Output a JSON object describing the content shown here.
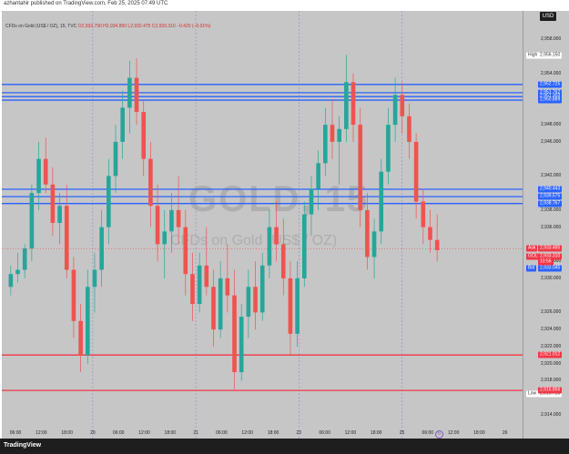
{
  "header": {
    "publisher": "azhantahir published on TradingView.com, Feb 25, 2025 07:49 UTC"
  },
  "legend": {
    "symbol": "CFDs on Gold (US$ / OZ), 15, TVC",
    "ohlc": "O2,933.790 H2,934.800 L2,932.475 C2,933.310 −0.420 (−0.01%)"
  },
  "watermark": {
    "ticker": "GOLD, 15",
    "description": "CFDs on Gold (US$ / OZ)"
  },
  "currency_button": "USD",
  "footer": {
    "logo_text": "TradingView"
  },
  "reset_icon": "reset-chart-icon",
  "colors": {
    "background": "#c6c6c6",
    "up": "#26a69a",
    "down": "#ef5350",
    "blue_level": "#2962ff",
    "red_level": "#f23645"
  },
  "chart_data": {
    "type": "candlestick",
    "symbol": "GOLD",
    "interval": "15",
    "ylim": [
      2912.5,
      2959
    ],
    "y_ticks": [
      "2,958.000",
      "2,954.000",
      "2,948.000",
      "2,946.000",
      "2,942.000",
      "2,938.000",
      "2,936.000",
      "2,932.000",
      "2,930.000",
      "2,926.000",
      "2,924.000",
      "2,922.000",
      "2,920.000",
      "2,918.000",
      "2,914.000"
    ],
    "y_tick_values": [
      2958,
      2954,
      2948,
      2946,
      2942,
      2938,
      2936,
      2932,
      2930,
      2926,
      2924,
      2922,
      2920,
      2918,
      2914
    ],
    "x_ticks": [
      "06:00",
      "12:00",
      "18:00",
      "20",
      "06:00",
      "12:00",
      "18:00",
      "21",
      "06:00",
      "12:00",
      "18:00",
      "23",
      "06:00",
      "12:00",
      "18:00",
      "25",
      "06:00",
      "12:00",
      "18:00",
      "26"
    ],
    "x_tick_positions": [
      0,
      1,
      2,
      3,
      4,
      5,
      6,
      7,
      8,
      9,
      10,
      11,
      12,
      13,
      14,
      15,
      16,
      17,
      18,
      19
    ],
    "day_separators": [
      3,
      7,
      11,
      15
    ],
    "high": {
      "label": "High",
      "value": "2,956.150",
      "y": 2956.15
    },
    "low": {
      "label": "Low",
      "value": "2,916.415",
      "y": 2916.415
    },
    "levels": [
      {
        "value": "2,952.725",
        "y": 2952.725,
        "color": "blue",
        "tag": ""
      },
      {
        "value": "2,951.762",
        "y": 2951.762,
        "color": "blue",
        "tag": ""
      },
      {
        "value": "2,951.303",
        "y": 2951.303,
        "color": "blue",
        "tag": ""
      },
      {
        "value": "2,950.889",
        "y": 2950.889,
        "color": "blue",
        "tag": ""
      },
      {
        "value": "2,940.443",
        "y": 2940.443,
        "color": "blue",
        "tag": ""
      },
      {
        "value": "2,939.575",
        "y": 2939.575,
        "color": "blue",
        "tag": ""
      },
      {
        "value": "2,938.767",
        "y": 2938.767,
        "color": "blue",
        "tag": ""
      },
      {
        "value": "2,921.012",
        "y": 2921.012,
        "color": "red",
        "tag": ""
      },
      {
        "value": "2,916.856",
        "y": 2916.856,
        "color": "red",
        "tag": ""
      }
    ],
    "price_tags": [
      {
        "label": "Ask",
        "value": "2,933.485",
        "y": 2933.485
      },
      {
        "label": "GOLD",
        "value": "2,933.310",
        "sub": "10:56",
        "y": 2932.6
      },
      {
        "label": "Bid",
        "value": "2,933.045",
        "y": 2931.2
      }
    ],
    "candles": [
      [
        2929,
        2931.5,
        2928,
        2930.5
      ],
      [
        2930.5,
        2933,
        2929.5,
        2931
      ],
      [
        2931,
        2934,
        2930,
        2933.5
      ],
      [
        2933.5,
        2941,
        2932,
        2940
      ],
      [
        2940,
        2946,
        2938,
        2944
      ],
      [
        2944,
        2946.5,
        2940,
        2941
      ],
      [
        2941,
        2943,
        2935,
        2936.5
      ],
      [
        2936.5,
        2940,
        2934,
        2938.5
      ],
      [
        2938.5,
        2941,
        2930,
        2931
      ],
      [
        2931,
        2932.5,
        2923,
        2925
      ],
      [
        2925,
        2927,
        2919,
        2921
      ],
      [
        2921,
        2931,
        2920,
        2929
      ],
      [
        2929,
        2933,
        2926,
        2931
      ],
      [
        2931,
        2938,
        2929,
        2936
      ],
      [
        2936,
        2944,
        2934,
        2942
      ],
      [
        2942,
        2948,
        2940,
        2946
      ],
      [
        2946,
        2952,
        2944,
        2950
      ],
      [
        2950,
        2955.5,
        2947,
        2953.5
      ],
      [
        2953.5,
        2955.8,
        2948,
        2949.5
      ],
      [
        2949.5,
        2951,
        2942,
        2944
      ],
      [
        2944,
        2946,
        2936,
        2938.5
      ],
      [
        2938.5,
        2941,
        2932,
        2934
      ],
      [
        2934,
        2938,
        2930,
        2935.5
      ],
      [
        2935.5,
        2940,
        2933,
        2938
      ],
      [
        2938,
        2942,
        2934,
        2936
      ],
      [
        2936,
        2938,
        2928,
        2930.5
      ],
      [
        2930.5,
        2933,
        2925,
        2927
      ],
      [
        2927,
        2933,
        2926,
        2931.5
      ],
      [
        2931.5,
        2936,
        2928,
        2929
      ],
      [
        2929,
        2931,
        2922,
        2924
      ],
      [
        2924,
        2932,
        2923,
        2930
      ],
      [
        2930,
        2934,
        2926,
        2928
      ],
      [
        2928,
        2931,
        2917,
        2919
      ],
      [
        2919,
        2927,
        2918,
        2925.5
      ],
      [
        2925.5,
        2931,
        2923,
        2929
      ],
      [
        2929,
        2932,
        2924,
        2926
      ],
      [
        2926,
        2933,
        2925,
        2931.5
      ],
      [
        2931.5,
        2938,
        2930,
        2936
      ],
      [
        2936,
        2939,
        2932,
        2934
      ],
      [
        2934,
        2937,
        2928,
        2930
      ],
      [
        2930,
        2932,
        2921,
        2923.5
      ],
      [
        2923.5,
        2932,
        2922,
        2930
      ],
      [
        2930,
        2939,
        2929,
        2937.5
      ],
      [
        2937.5,
        2942,
        2935,
        2940.5
      ],
      [
        2940.5,
        2945,
        2938,
        2943.5
      ],
      [
        2943.5,
        2950,
        2942,
        2948
      ],
      [
        2948,
        2951,
        2944,
        2946
      ],
      [
        2946,
        2949,
        2941,
        2947.5
      ],
      [
        2947.5,
        2956.2,
        2946,
        2953
      ],
      [
        2953,
        2954,
        2946,
        2948
      ],
      [
        2948,
        2950,
        2936,
        2938
      ],
      [
        2938,
        2940,
        2931,
        2932.5
      ],
      [
        2932.5,
        2937,
        2930,
        2935.5
      ],
      [
        2935.5,
        2944,
        2934,
        2942.5
      ],
      [
        2942.5,
        2950,
        2941,
        2948
      ],
      [
        2948,
        2953.5,
        2946,
        2951.5
      ],
      [
        2951.5,
        2953,
        2947,
        2949
      ],
      [
        2949,
        2950.5,
        2944,
        2946
      ],
      [
        2946,
        2947,
        2937,
        2939
      ],
      [
        2939,
        2940.5,
        2934,
        2936
      ],
      [
        2936,
        2938,
        2933,
        2934.5
      ],
      [
        2934.5,
        2937.5,
        2932,
        2933.3
      ]
    ]
  }
}
